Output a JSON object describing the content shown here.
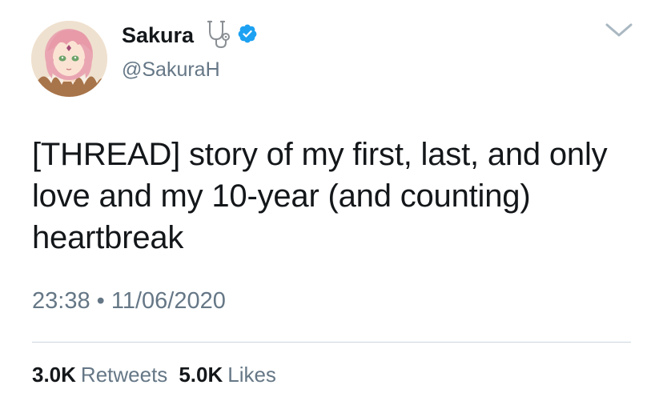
{
  "user": {
    "display_name": "Sakura",
    "handle": "@SakuraH",
    "verified": true,
    "name_emoji": "stethoscope-icon",
    "avatar": "anime-avatar-pink-hair"
  },
  "tweet": {
    "text": "[THREAD] story of my first, last, and only love and my 10-year (and counting) heartbreak",
    "time": "23:38",
    "separator": "•",
    "date": "11/06/2020"
  },
  "stats": {
    "retweets_count": "3.0K",
    "retweets_label": "Retweets",
    "likes_count": "5.0K",
    "likes_label": "Likes"
  },
  "colors": {
    "primary_text": "#14171a",
    "secondary_text": "#657786",
    "verified_blue": "#1da1f2",
    "divider": "#ccd6dd"
  }
}
